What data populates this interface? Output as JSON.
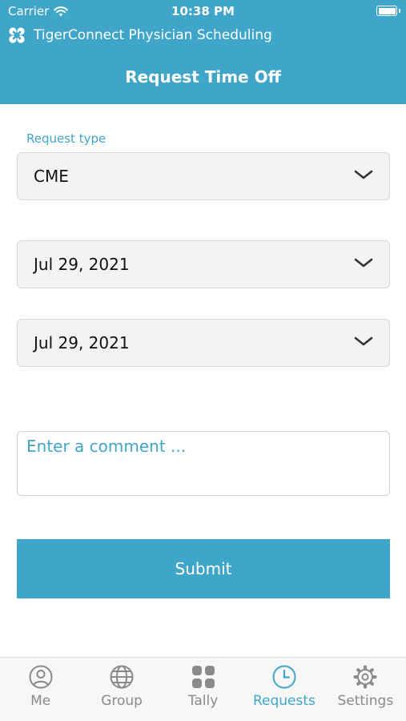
{
  "status_bar": {
    "carrier": "Carrier",
    "time": "10:38 PM"
  },
  "app": {
    "name": "TigerConnect Physician Scheduling"
  },
  "page": {
    "title": "Request Time Off"
  },
  "form": {
    "request_type_label": "Request type",
    "request_type_value": "CME",
    "start_date": "Jul 29, 2021",
    "end_date": "Jul 29, 2021",
    "comment_placeholder": "Enter a comment ...",
    "submit_label": "Submit"
  },
  "tabs": [
    {
      "label": "Me",
      "icon": "person-icon",
      "active": false
    },
    {
      "label": "Group",
      "icon": "globe-icon",
      "active": false
    },
    {
      "label": "Tally",
      "icon": "grid-icon",
      "active": false
    },
    {
      "label": "Requests",
      "icon": "clock-icon",
      "active": true
    },
    {
      "label": "Settings",
      "icon": "gear-icon",
      "active": false
    }
  ],
  "colors": {
    "accent": "#3fa5c9",
    "field_bg": "#f2f3f5",
    "inactive_tab": "#8a8a8a"
  }
}
